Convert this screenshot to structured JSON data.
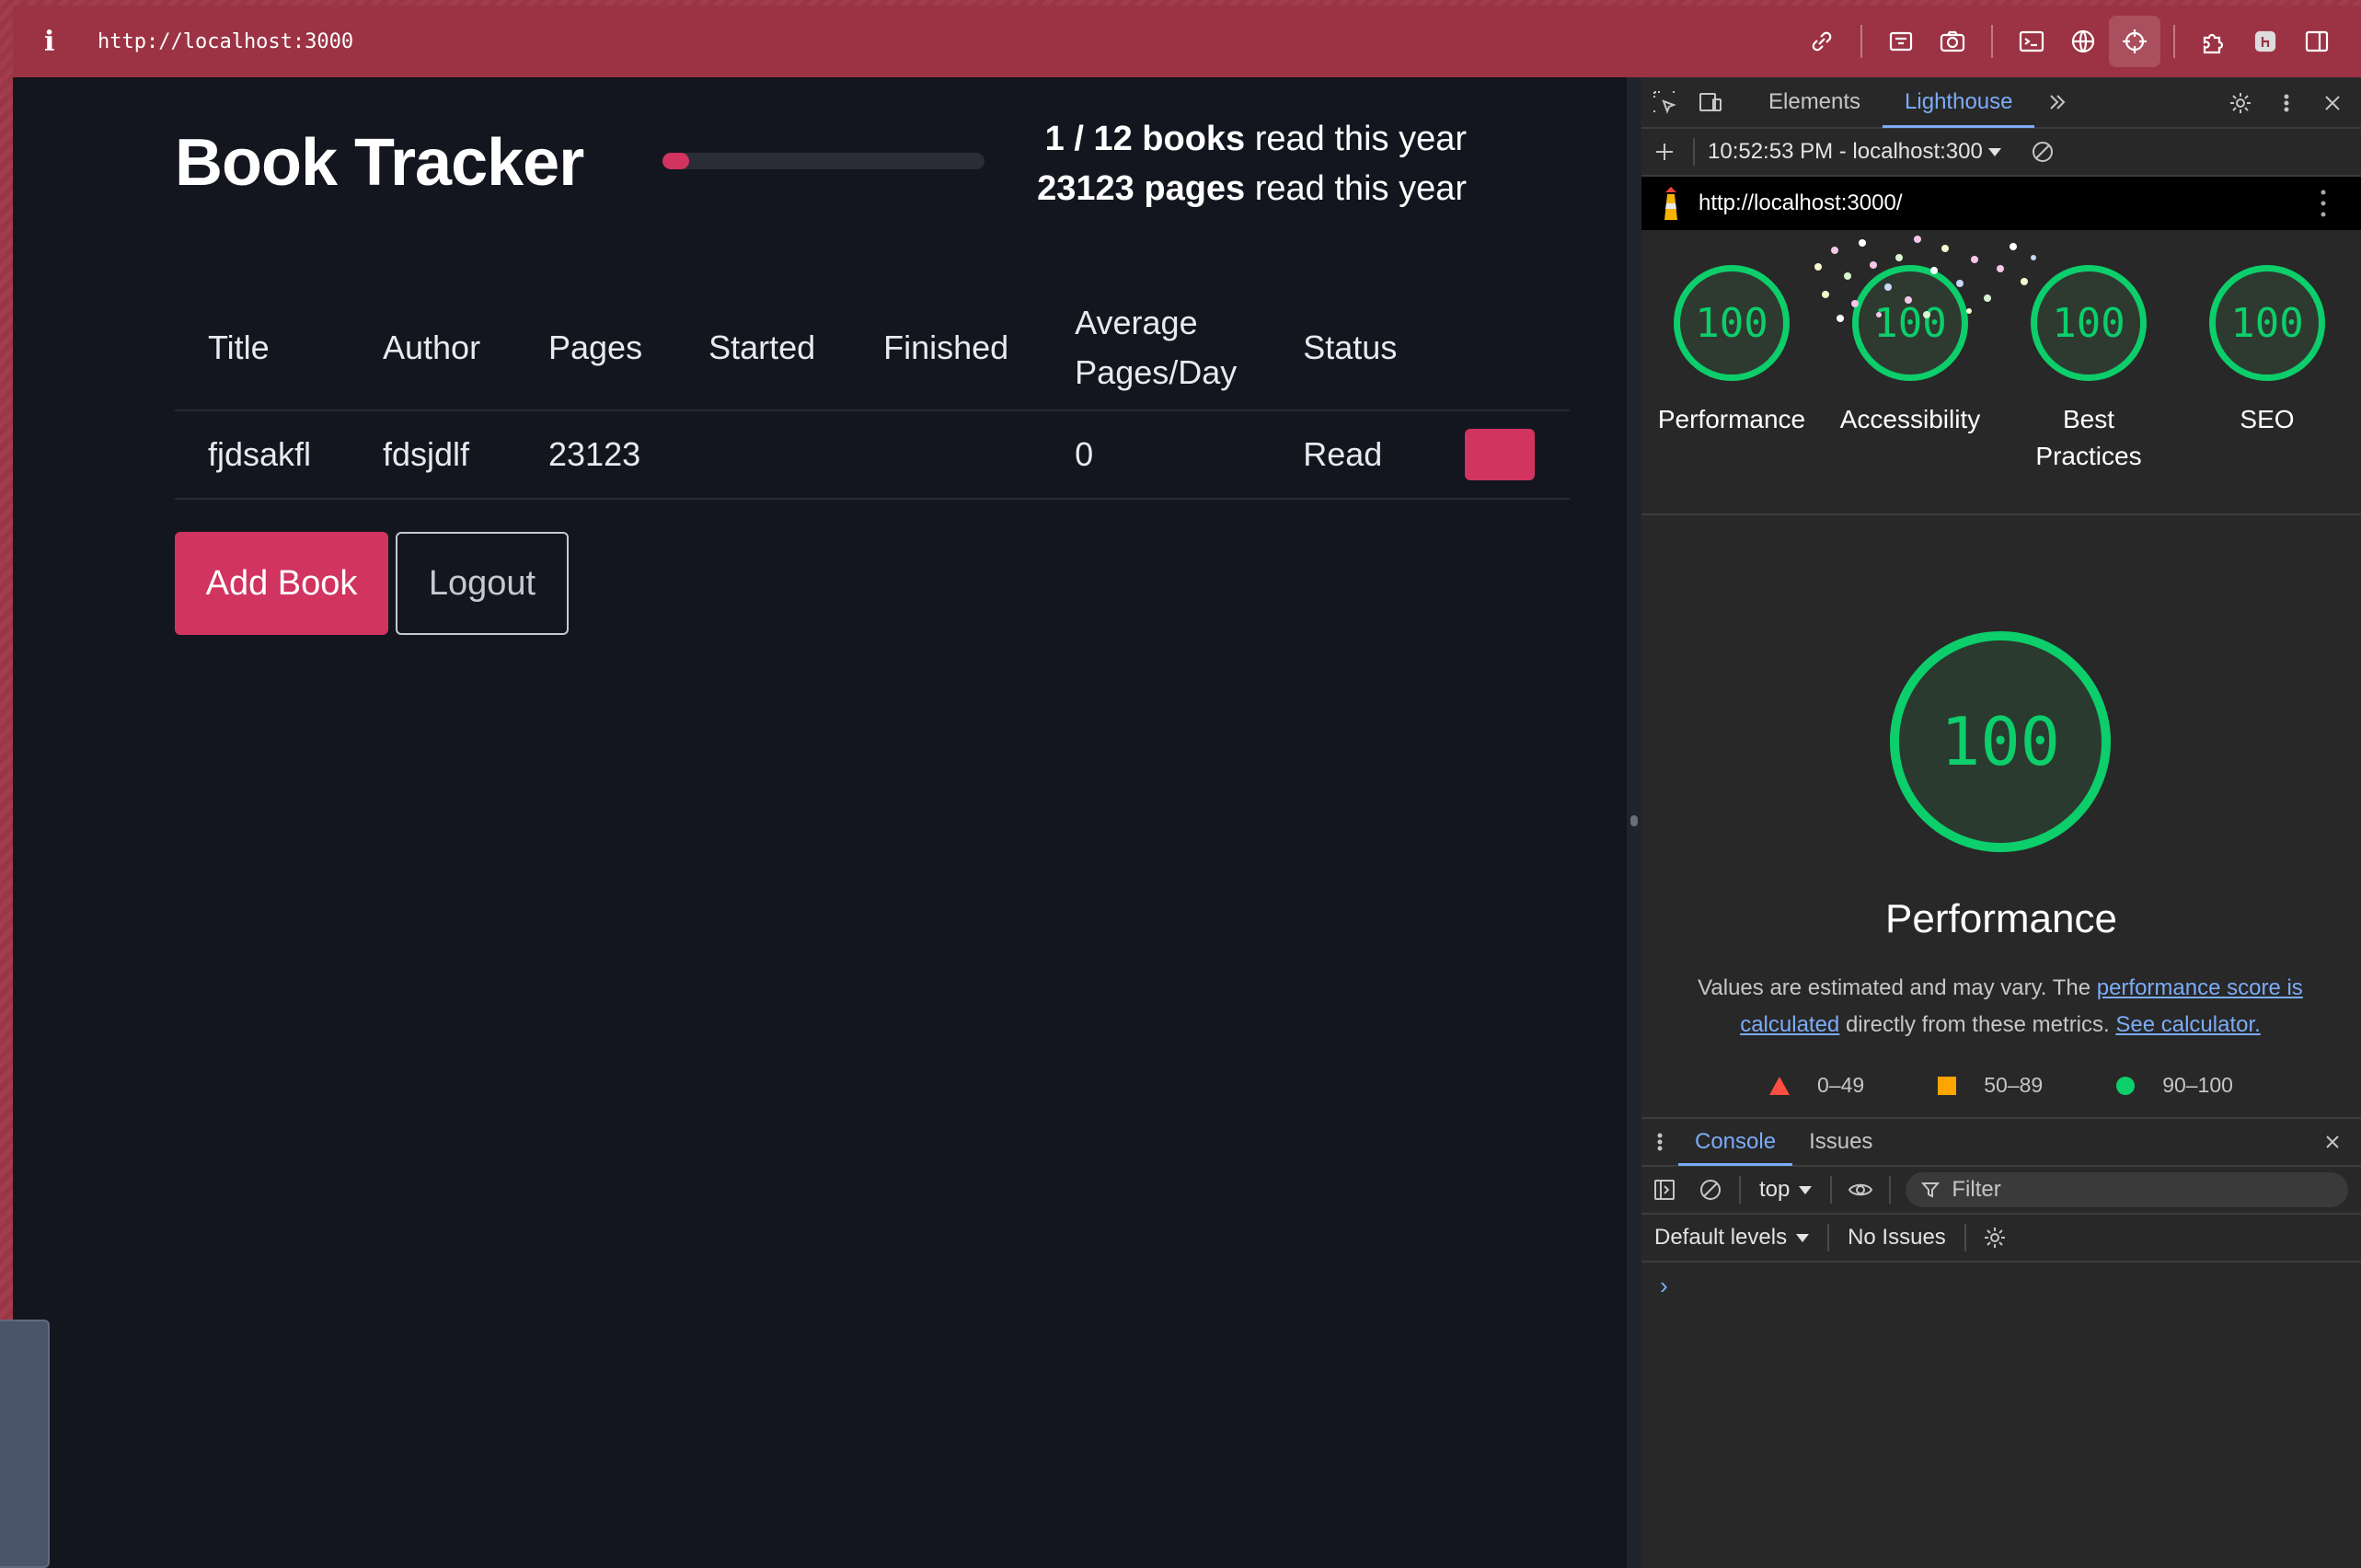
{
  "browser": {
    "url": "http://localhost:3000"
  },
  "app": {
    "title": "Book Tracker",
    "progress_fraction": 0.0833,
    "stats": {
      "books_strong": "1 / 12 books",
      "books_rest": " read this year",
      "pages_strong": "23123 pages",
      "pages_rest": " read this year"
    },
    "table": {
      "headers": {
        "title": "Title",
        "author": "Author",
        "pages": "Pages",
        "started": "Started",
        "finished": "Finished",
        "avg_line1": "Average",
        "avg_line2": "Pages/Day",
        "status": "Status"
      },
      "rows": [
        {
          "title": "fjdsakfl",
          "author": "fdsjdlf",
          "pages": "23123",
          "started": "",
          "finished": "",
          "avg": "0",
          "status": "Read"
        }
      ]
    },
    "buttons": {
      "add": "Add Book",
      "logout": "Logout"
    }
  },
  "devtools": {
    "tabs": {
      "elements": "Elements",
      "lighthouse": "Lighthouse"
    },
    "report_stamp": "10:52:53 PM - localhost:300",
    "report_url": "http://localhost:3000/",
    "scores": [
      {
        "label": "Performance",
        "value": "100"
      },
      {
        "label": "Accessibility",
        "value": "100"
      },
      {
        "label": "Best Practices",
        "value": "100"
      },
      {
        "label": "SEO",
        "value": "100"
      }
    ],
    "big_score": {
      "value": "100",
      "title": "Performance"
    },
    "note": {
      "text1": "Values are estimated and may vary. The ",
      "link1": "performance score is calculated",
      "text2": " directly from these metrics. ",
      "link2": "See calculator."
    },
    "legend": {
      "fail": "0–49",
      "average": "50–89",
      "pass": "90–100"
    },
    "drawer": {
      "console_tab": "Console",
      "issues_tab": "Issues",
      "context": "top",
      "filter_placeholder": "Filter",
      "levels": "Default levels",
      "issues_status": "No Issues",
      "prompt": "›"
    },
    "colors": {
      "pass": "#0cce6b",
      "average": "#ffa400",
      "fail": "#ff4e42",
      "accent": "#7cacf8"
    }
  },
  "colors": {
    "brand": "#d0345f",
    "frame": "#9b3344",
    "app_bg": "#13161e"
  }
}
